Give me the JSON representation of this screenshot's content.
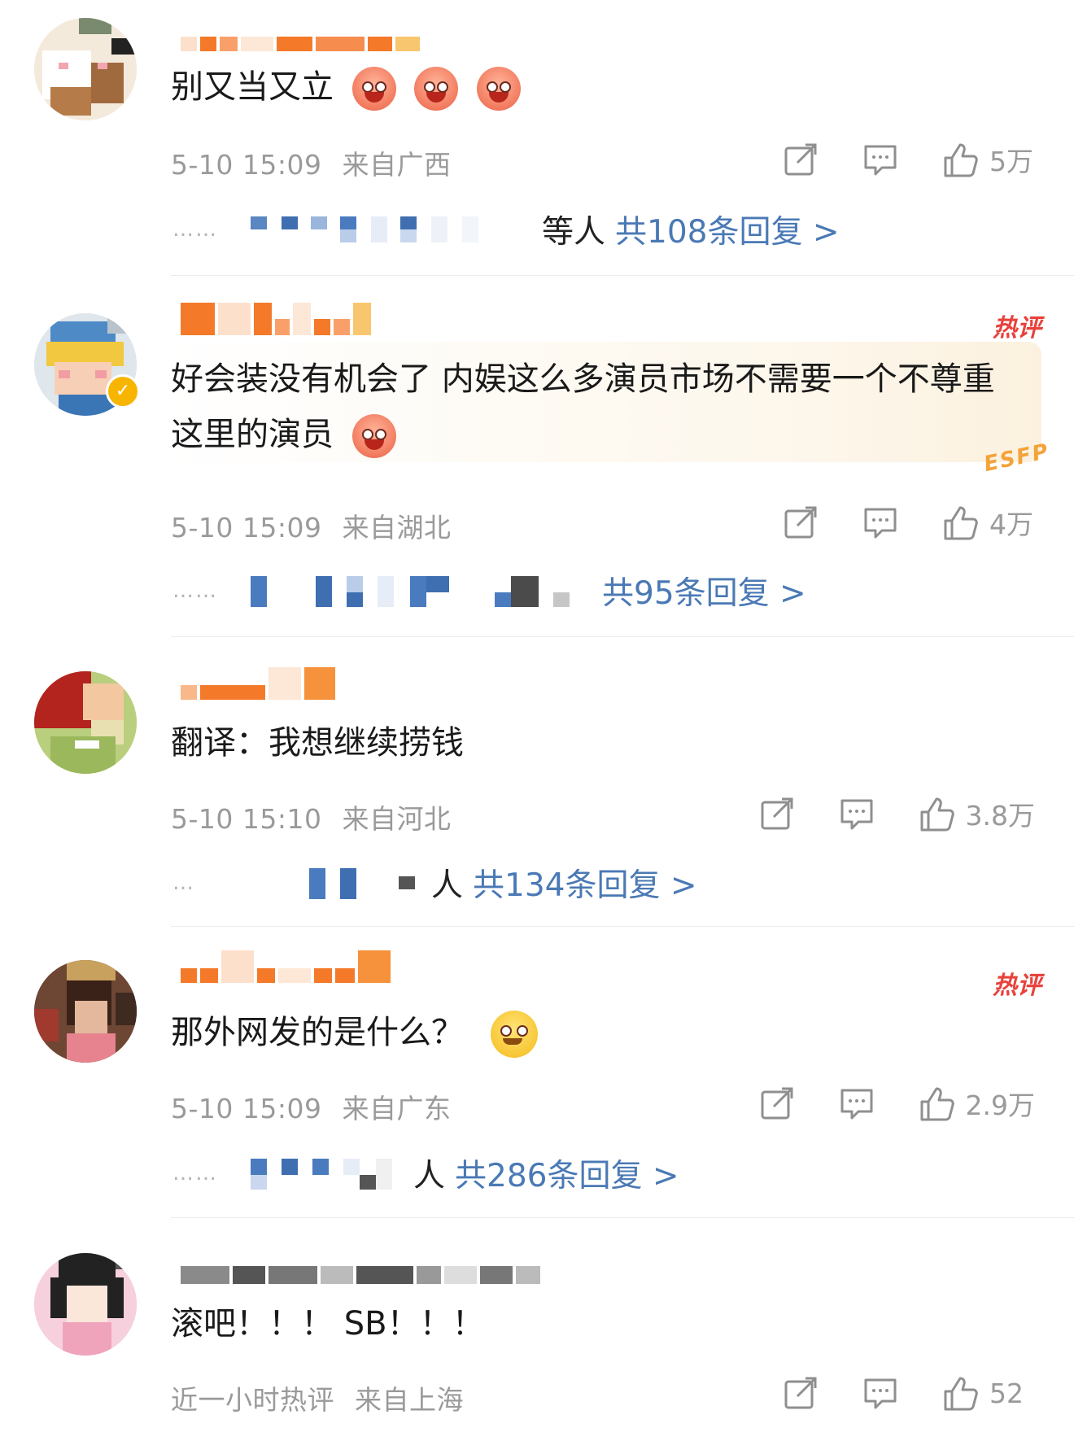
{
  "comments": [
    {
      "text": "别又当又立",
      "time": "5-10 15:09",
      "location": "来自广西",
      "likes": "5万",
      "reply_tail": "等人",
      "reply_summary": "共108条回复 >",
      "hot": false
    },
    {
      "text": "好会装没有机会了 内娱这么多演员市场不需要一个不尊重这里的演员",
      "time": "5-10 15:09",
      "location": "来自湖北",
      "likes": "4万",
      "reply_tail": "",
      "reply_summary": "共95条回复 >",
      "hot": true,
      "hot_label": "热评",
      "badge": "ESFP"
    },
    {
      "text": "翻译：我想继续捞钱",
      "time": "5-10 15:10",
      "location": "来自河北",
      "likes": "3.8万",
      "reply_tail": "人",
      "reply_summary": "共134条回复 >",
      "hot": false
    },
    {
      "text": "那外网发的是什么？",
      "time": "5-10 15:09",
      "location": "来自广东",
      "likes": "2.9万",
      "reply_tail": "人",
      "reply_summary": "共286条回复 >",
      "hot": true,
      "hot_label": "热评"
    },
    {
      "text": "滚吧！！！ SB！！！",
      "time": "近一小时热评",
      "location": "来自上海",
      "likes": "52",
      "hot": false
    }
  ],
  "icons": {
    "share": "share-icon",
    "comment": "comment-icon",
    "like": "thumbs-up-icon"
  },
  "colors": {
    "link": "#4a79b5",
    "meta": "#9a9a9a",
    "hot": "#e8423c",
    "username_mosaic": "#f47a2a"
  }
}
